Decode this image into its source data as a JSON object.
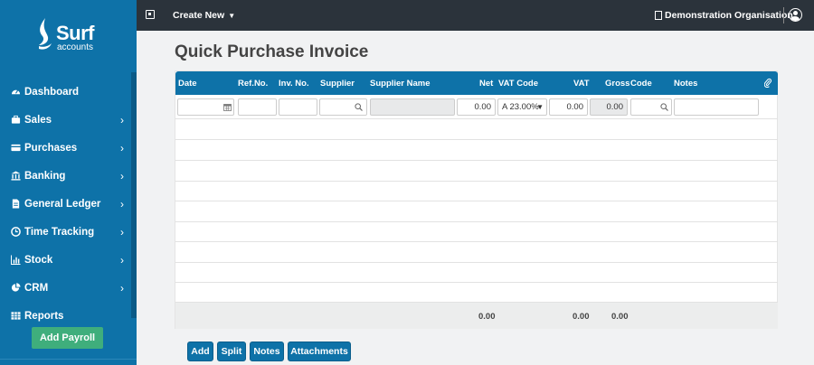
{
  "brand": {
    "name": "Surf",
    "sub": "accounts"
  },
  "sidebar": {
    "items": [
      {
        "label": "Dashboard",
        "icon": "dashboard-icon",
        "has_children": false
      },
      {
        "label": "Sales",
        "icon": "briefcase-icon",
        "has_children": true
      },
      {
        "label": "Purchases",
        "icon": "card-icon",
        "has_children": true
      },
      {
        "label": "Banking",
        "icon": "bank-icon",
        "has_children": true
      },
      {
        "label": "General Ledger",
        "icon": "document-icon",
        "has_children": true
      },
      {
        "label": "Time Tracking",
        "icon": "clock-icon",
        "has_children": true
      },
      {
        "label": "Stock",
        "icon": "bar-chart-icon",
        "has_children": true
      },
      {
        "label": "CRM",
        "icon": "pie-chart-icon",
        "has_children": true
      },
      {
        "label": "Reports",
        "icon": "table-icon",
        "has_children": false
      }
    ],
    "payroll_button": "Add Payroll",
    "chevron": "›"
  },
  "topbar": {
    "create_new": "Create New",
    "organisation": "Demonstration Organisation"
  },
  "page": {
    "title": "Quick Purchase Invoice"
  },
  "grid": {
    "columns": [
      "Date",
      "Ref.No.",
      "Inv. No.",
      "Supplier",
      "Supplier Name",
      "Net",
      "VAT Code",
      "VAT",
      "Gross",
      "Code",
      "Notes"
    ],
    "entry_row": {
      "date": "",
      "ref_no": "",
      "inv_no": "",
      "supplier": "",
      "supplier_name": "",
      "net": "0.00",
      "vat_code": "A 23.00%",
      "vat": "0.00",
      "gross": "0.00",
      "code": "",
      "notes": ""
    },
    "empty_rows": 9,
    "totals": {
      "net": "0.00",
      "vat": "0.00",
      "gross": "0.00"
    }
  },
  "actions": {
    "add": "Add",
    "split": "Split",
    "notes": "Notes",
    "attachments": "Attachments"
  },
  "colors": {
    "primary": "#0e72a8",
    "topbar": "#2b333b",
    "payroll": "#3fae7c",
    "background": "#f1f2f3"
  }
}
